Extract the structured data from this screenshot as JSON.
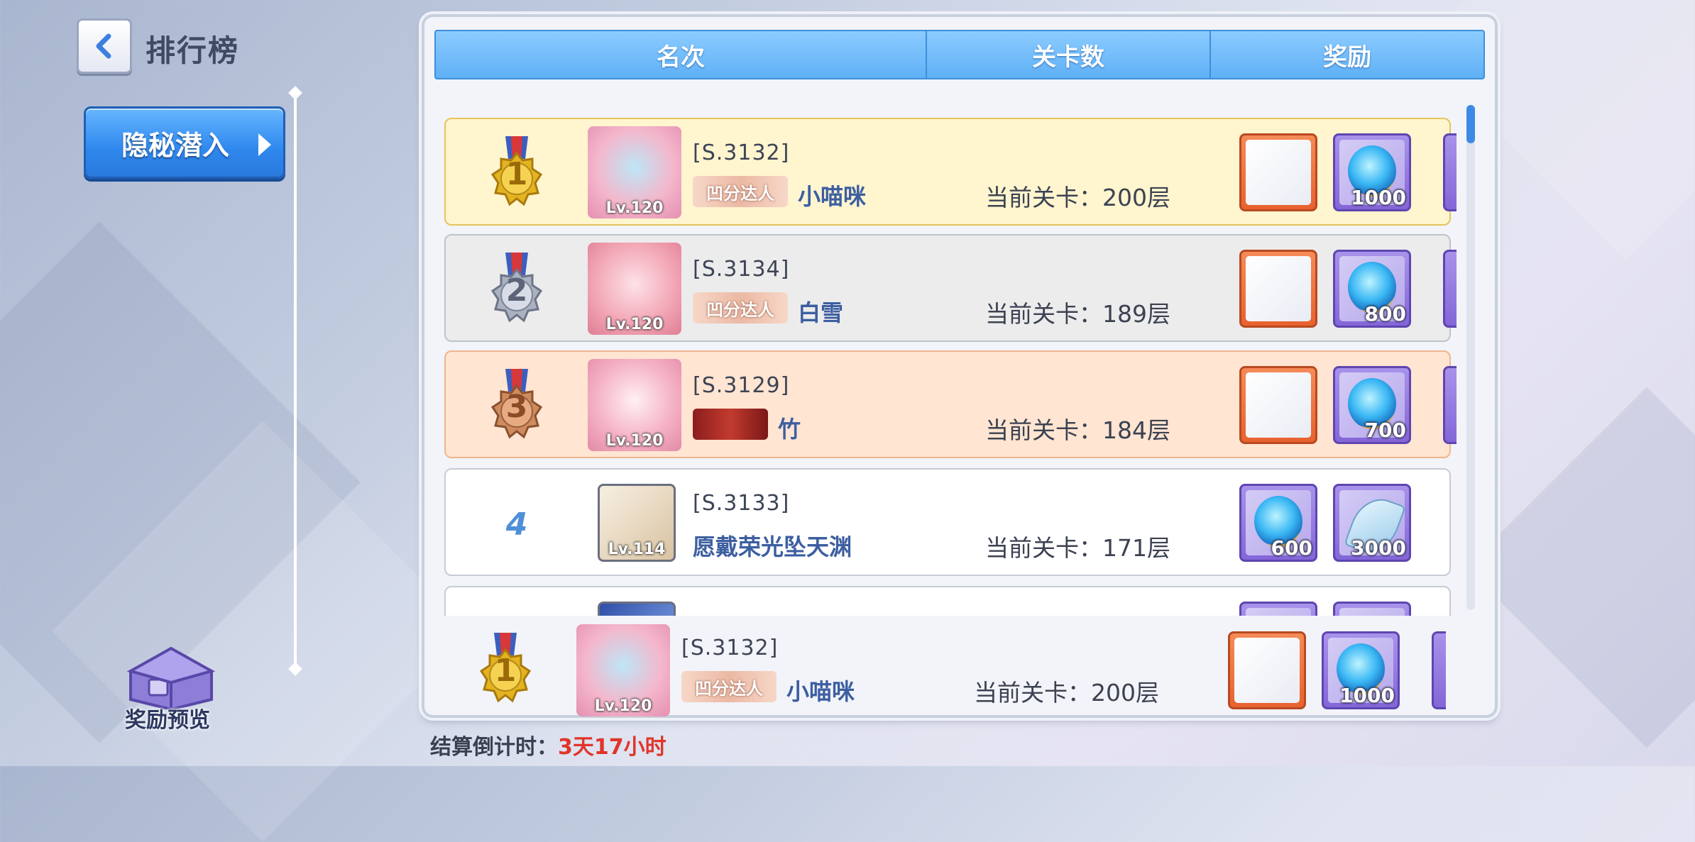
{
  "header": {
    "title": "排行榜"
  },
  "sidebar": {
    "mode_label": "隐秘潜入",
    "reward_preview_label": "奖励预览"
  },
  "table": {
    "columns": [
      "名次",
      "关卡数",
      "奖励"
    ],
    "rows": [
      {
        "rank": "1",
        "server": "[S.3132]",
        "title_badge": "凹分达人",
        "name": "小喵咪",
        "level": "Lv.120",
        "stage": "当前关卡：200层",
        "rewards": [
          {
            "icon": "frame-item-icon",
            "qty": ""
          },
          {
            "icon": "gold-coin-icon",
            "qty": "1000"
          }
        ]
      },
      {
        "rank": "2",
        "server": "[S.3134]",
        "title_badge": "凹分达人",
        "name": "白雪",
        "level": "Lv.120",
        "stage": "当前关卡：189层",
        "rewards": [
          {
            "icon": "frame-item-icon",
            "qty": ""
          },
          {
            "icon": "gold-coin-icon",
            "qty": "800"
          }
        ]
      },
      {
        "rank": "3",
        "server": "[S.3129]",
        "title_badge": "",
        "name": "竹",
        "level": "Lv.120",
        "stage": "当前关卡：184层",
        "rewards": [
          {
            "icon": "frame-item-icon",
            "qty": ""
          },
          {
            "icon": "gold-coin-icon",
            "qty": "700"
          }
        ]
      },
      {
        "rank": "4",
        "server": "[S.3133]",
        "title_badge": "",
        "name": "愿戴荣光坠天渊",
        "level": "Lv.114",
        "stage": "当前关卡：171层",
        "rewards": [
          {
            "icon": "gold-coin-icon",
            "qty": "600"
          },
          {
            "icon": "crystal-leaf-icon",
            "qty": "3000"
          }
        ]
      }
    ],
    "my_rank": {
      "rank": "1",
      "server": "[S.3132]",
      "title_badge": "凹分达人",
      "name": "小喵咪",
      "level": "Lv.120",
      "stage": "当前关卡：200层",
      "rewards": [
        {
          "icon": "frame-item-icon",
          "qty": ""
        },
        {
          "icon": "gold-coin-icon",
          "qty": "1000"
        }
      ]
    }
  },
  "footer": {
    "countdown_label": "结算倒计时：",
    "countdown_value": "3天17小时"
  },
  "colors": {
    "accent": "#3d8ae6",
    "countdown": "#e0352b",
    "gold_row": "#fff5cf",
    "silver_row": "#ececed",
    "bronze_row": "#ffe5d2"
  }
}
